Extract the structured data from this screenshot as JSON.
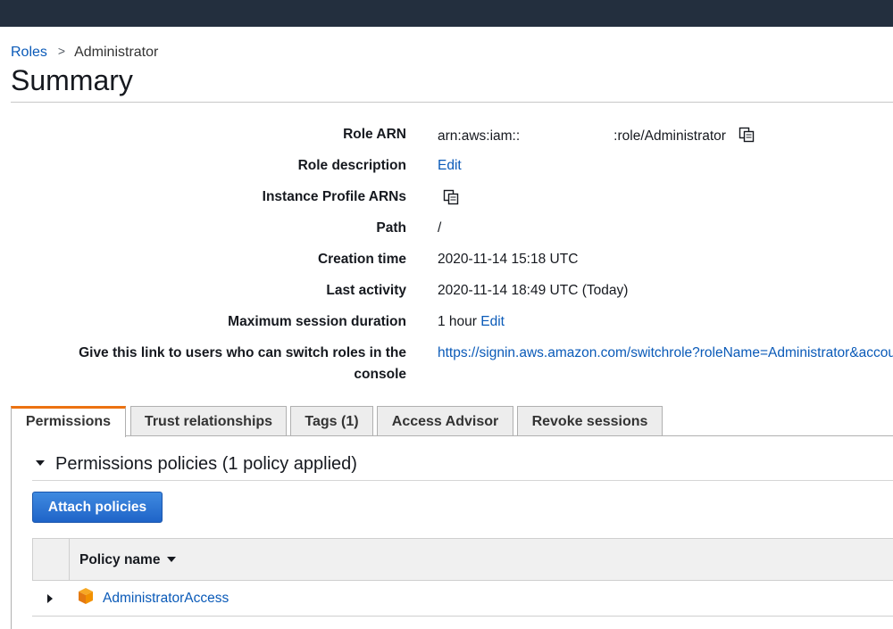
{
  "breadcrumb": {
    "parent": "Roles",
    "separator": ">",
    "current": "Administrator"
  },
  "page_title": "Summary",
  "summary": {
    "role_arn_label": "Role ARN",
    "role_arn_prefix": "arn:aws:iam::",
    "role_arn_suffix": ":role/Administrator",
    "role_description_label": "Role description",
    "role_description_link": "Edit",
    "instance_profile_label": "Instance Profile ARNs",
    "path_label": "Path",
    "path_value": "/",
    "creation_time_label": "Creation time",
    "creation_time_value": "2020-11-14 15:18 UTC",
    "last_activity_label": "Last activity",
    "last_activity_value": "2020-11-14 18:49 UTC (Today)",
    "max_session_label": "Maximum session duration",
    "max_session_value": "1 hour",
    "max_session_link": "Edit",
    "switch_link_label_1": "Give this link to users who can switch roles in the",
    "switch_link_label_2": "console",
    "switch_link_value": "https://signin.aws.amazon.com/switchrole?roleName=Administrator&account="
  },
  "tabs": [
    {
      "label": "Permissions",
      "active": true
    },
    {
      "label": "Trust relationships",
      "active": false
    },
    {
      "label": "Tags (1)",
      "active": false
    },
    {
      "label": "Access Advisor",
      "active": false
    },
    {
      "label": "Revoke sessions",
      "active": false
    }
  ],
  "permissions": {
    "section_title": "Permissions policies (1 policy applied)",
    "attach_button": "Attach policies",
    "column_policy_name": "Policy name",
    "policies": [
      {
        "name": "AdministratorAccess",
        "icon": "aws-managed-policy-cube-icon"
      }
    ]
  },
  "colors": {
    "topbar": "#232f3e",
    "link": "#0a5ab8",
    "accent": "#ec7211",
    "button": "#1f64c8",
    "policy_icon": "#f29100"
  }
}
